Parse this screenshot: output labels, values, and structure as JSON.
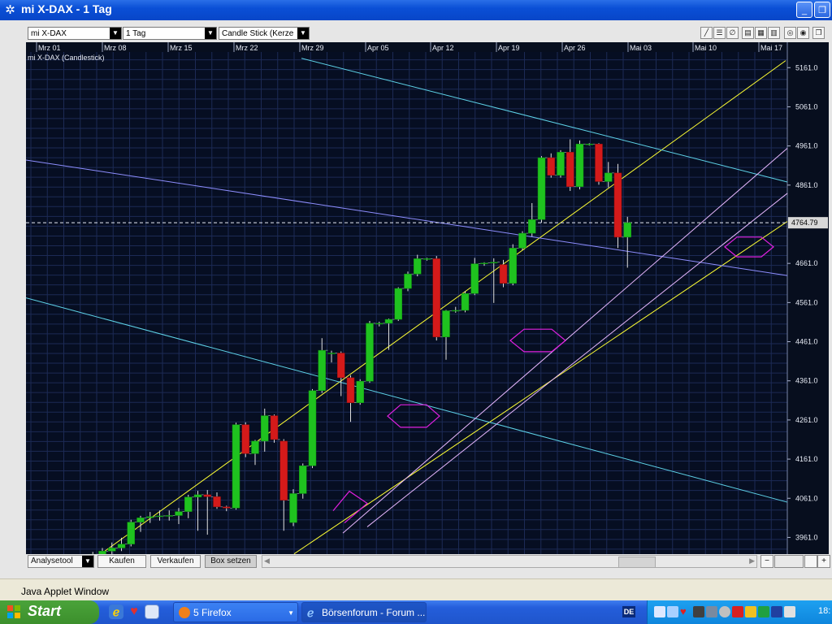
{
  "window": {
    "title": "mi X-DAX - 1 Tag",
    "minimize_glyph": "_",
    "restore_glyph": "❐"
  },
  "toolbar": {
    "instrument": "mi X-DAX",
    "period": "1 Tag",
    "chart_type": "Candle Stick (Kerze",
    "tools": [
      "line-tool-icon",
      "hline-tool-icon",
      "fib-tool-icon",
      "grid1-icon",
      "grid2-icon",
      "grid3-icon",
      "zoom-icon",
      "settings-icon",
      "detach-icon"
    ]
  },
  "chart": {
    "series_label": "mi X-DAX (Candlestick)",
    "date_labels": [
      "Mrz 01",
      "Mrz 08",
      "Mrz 15",
      "Mrz 22",
      "Mrz 29",
      "Apr 05",
      "Apr 12",
      "Apr 19",
      "Apr 26",
      "Mai 03",
      "Mai 10",
      "Mai 17"
    ],
    "price_labels": [
      "5161.0",
      "5061.0",
      "4961.0",
      "4861.0",
      "4661.0",
      "4561.0",
      "4461.0",
      "4361.0",
      "4261.0",
      "4161.0",
      "4061.0",
      "3961.0"
    ],
    "last_price": "4764.79",
    "colors": {
      "background": "#060e22",
      "grid": "#1c2a55",
      "up": "#1fc21f",
      "down": "#d41a1a",
      "channel": "#ffff33",
      "resistance": "#5ed3e8",
      "trend": "#8e8eff",
      "support_light": "#e8b8ff",
      "marker": "#e020e0"
    }
  },
  "chart_data": {
    "type": "candlestick",
    "title": "mi X-DAX (Candlestick)",
    "xlabel": "",
    "ylabel": "",
    "x_ticks": [
      "Mrz 01",
      "Mrz 08",
      "Mrz 15",
      "Mrz 22",
      "Mrz 29",
      "Apr 05",
      "Apr 12",
      "Apr 19",
      "Apr 26",
      "Mai 03",
      "Mai 10",
      "Mai 17"
    ],
    "y_ticks": [
      5161.0,
      5061.0,
      4961.0,
      4861.0,
      4661.0,
      4561.0,
      4461.0,
      4361.0,
      4261.0,
      4161.0,
      4061.0,
      3961.0
    ],
    "ylim": [
      3919,
      5201
    ],
    "last_value": 4764.79,
    "candles": [
      {
        "o": 3892,
        "h": 3904,
        "l": 3878,
        "c": 3898
      },
      {
        "o": 3898,
        "h": 3912,
        "l": 3888,
        "c": 3902
      },
      {
        "o": 3902,
        "h": 3918,
        "l": 3894,
        "c": 3910
      },
      {
        "o": 3910,
        "h": 3924,
        "l": 3904,
        "c": 3918
      },
      {
        "o": 3918,
        "h": 3934,
        "l": 3912,
        "c": 3926
      },
      {
        "o": 3926,
        "h": 3948,
        "l": 3918,
        "c": 3934
      },
      {
        "o": 3934,
        "h": 3960,
        "l": 3926,
        "c": 3944
      },
      {
        "o": 3944,
        "h": 4006,
        "l": 3938,
        "c": 4000
      },
      {
        "o": 4000,
        "h": 4016,
        "l": 3975,
        "c": 4011
      },
      {
        "o": 4011,
        "h": 4026,
        "l": 3998,
        "c": 4014
      },
      {
        "o": 4014,
        "h": 4030,
        "l": 4004,
        "c": 4016
      },
      {
        "o": 4016,
        "h": 4030,
        "l": 4004,
        "c": 4017
      },
      {
        "o": 4017,
        "h": 4036,
        "l": 3995,
        "c": 4027
      },
      {
        "o": 4027,
        "h": 4070,
        "l": 4010,
        "c": 4064
      },
      {
        "o": 4064,
        "h": 4080,
        "l": 3978,
        "c": 4070
      },
      {
        "o": 4070,
        "h": 4082,
        "l": 3968,
        "c": 4065
      },
      {
        "o": 4065,
        "h": 4076,
        "l": 4034,
        "c": 4039
      },
      {
        "o": 4039,
        "h": 4042,
        "l": 4028,
        "c": 4036
      },
      {
        "o": 4036,
        "h": 4254,
        "l": 4032,
        "c": 4249
      },
      {
        "o": 4249,
        "h": 4255,
        "l": 4166,
        "c": 4175
      },
      {
        "o": 4175,
        "h": 4210,
        "l": 4146,
        "c": 4207
      },
      {
        "o": 4207,
        "h": 4290,
        "l": 4180,
        "c": 4272
      },
      {
        "o": 4272,
        "h": 4275,
        "l": 4203,
        "c": 4211
      },
      {
        "o": 4207,
        "h": 4212,
        "l": 3978,
        "c": 4056
      },
      {
        "o": 3999,
        "h": 4084,
        "l": 3990,
        "c": 4073
      },
      {
        "o": 4073,
        "h": 4150,
        "l": 4060,
        "c": 4144
      },
      {
        "o": 4144,
        "h": 4340,
        "l": 4138,
        "c": 4336
      },
      {
        "o": 4336,
        "h": 4470,
        "l": 4330,
        "c": 4439
      },
      {
        "o": 4432,
        "h": 4438,
        "l": 4408,
        "c": 4432
      },
      {
        "o": 4432,
        "h": 4436,
        "l": 4322,
        "c": 4369
      },
      {
        "o": 4369,
        "h": 4375,
        "l": 4256,
        "c": 4305
      },
      {
        "o": 4305,
        "h": 4365,
        "l": 4300,
        "c": 4360
      },
      {
        "o": 4360,
        "h": 4514,
        "l": 4356,
        "c": 4508
      },
      {
        "o": 4508,
        "h": 4512,
        "l": 4500,
        "c": 4508
      },
      {
        "o": 4508,
        "h": 4520,
        "l": 4440,
        "c": 4518
      },
      {
        "o": 4518,
        "h": 4600,
        "l": 4514,
        "c": 4597
      },
      {
        "o": 4597,
        "h": 4640,
        "l": 4590,
        "c": 4634
      },
      {
        "o": 4634,
        "h": 4683,
        "l": 4628,
        "c": 4673
      },
      {
        "o": 4673,
        "h": 4675,
        "l": 4668,
        "c": 4673
      },
      {
        "o": 4673,
        "h": 4680,
        "l": 4464,
        "c": 4473
      },
      {
        "o": 4473,
        "h": 4542,
        "l": 4415,
        "c": 4540
      },
      {
        "o": 4540,
        "h": 4550,
        "l": 4535,
        "c": 4541
      },
      {
        "o": 4541,
        "h": 4590,
        "l": 4536,
        "c": 4584
      },
      {
        "o": 4584,
        "h": 4675,
        "l": 4580,
        "c": 4660
      },
      {
        "o": 4660,
        "h": 4664,
        "l": 4655,
        "c": 4662
      },
      {
        "o": 4662,
        "h": 4674,
        "l": 4560,
        "c": 4664
      },
      {
        "o": 4658,
        "h": 4670,
        "l": 4600,
        "c": 4610
      },
      {
        "o": 4610,
        "h": 4710,
        "l": 4605,
        "c": 4700
      },
      {
        "o": 4700,
        "h": 4743,
        "l": 4695,
        "c": 4738
      },
      {
        "o": 4738,
        "h": 4815,
        "l": 4730,
        "c": 4773
      },
      {
        "o": 4773,
        "h": 4935,
        "l": 4765,
        "c": 4931
      },
      {
        "o": 4931,
        "h": 4942,
        "l": 4880,
        "c": 4886
      },
      {
        "o": 4886,
        "h": 4950,
        "l": 4880,
        "c": 4945
      },
      {
        "o": 4945,
        "h": 4978,
        "l": 4846,
        "c": 4857
      },
      {
        "o": 4857,
        "h": 4975,
        "l": 4850,
        "c": 4966
      },
      {
        "o": 4966,
        "h": 4968,
        "l": 4962,
        "c": 4966
      },
      {
        "o": 4966,
        "h": 4968,
        "l": 4862,
        "c": 4870
      },
      {
        "o": 4870,
        "h": 4920,
        "l": 4855,
        "c": 4892
      },
      {
        "o": 4892,
        "h": 4915,
        "l": 4700,
        "c": 4728
      },
      {
        "o": 4728,
        "h": 4780,
        "l": 4650,
        "c": 4765
      }
    ],
    "annotations": [
      "yellow parallel trend channel",
      "cyan descending resistance lines",
      "blue trend line",
      "light violet support lines",
      "magenta hexagon markers",
      "dashed last-price line"
    ]
  },
  "bottom": {
    "analysetool": "Analysetool",
    "kaufen": "Kaufen",
    "verkaufen": "Verkaufen",
    "box_setzen": "Box setzen",
    "zoom_out": "−",
    "zoom_in": "+"
  },
  "status": {
    "text": "Java Applet Window"
  },
  "taskbar": {
    "start": "Start",
    "tasks": [
      {
        "label": "5 Firefox",
        "icon": "firefox-icon"
      },
      {
        "label": "Börsenforum - Forum ...",
        "icon": "ie-icon"
      }
    ],
    "lang": "DE",
    "clock": "18:"
  }
}
